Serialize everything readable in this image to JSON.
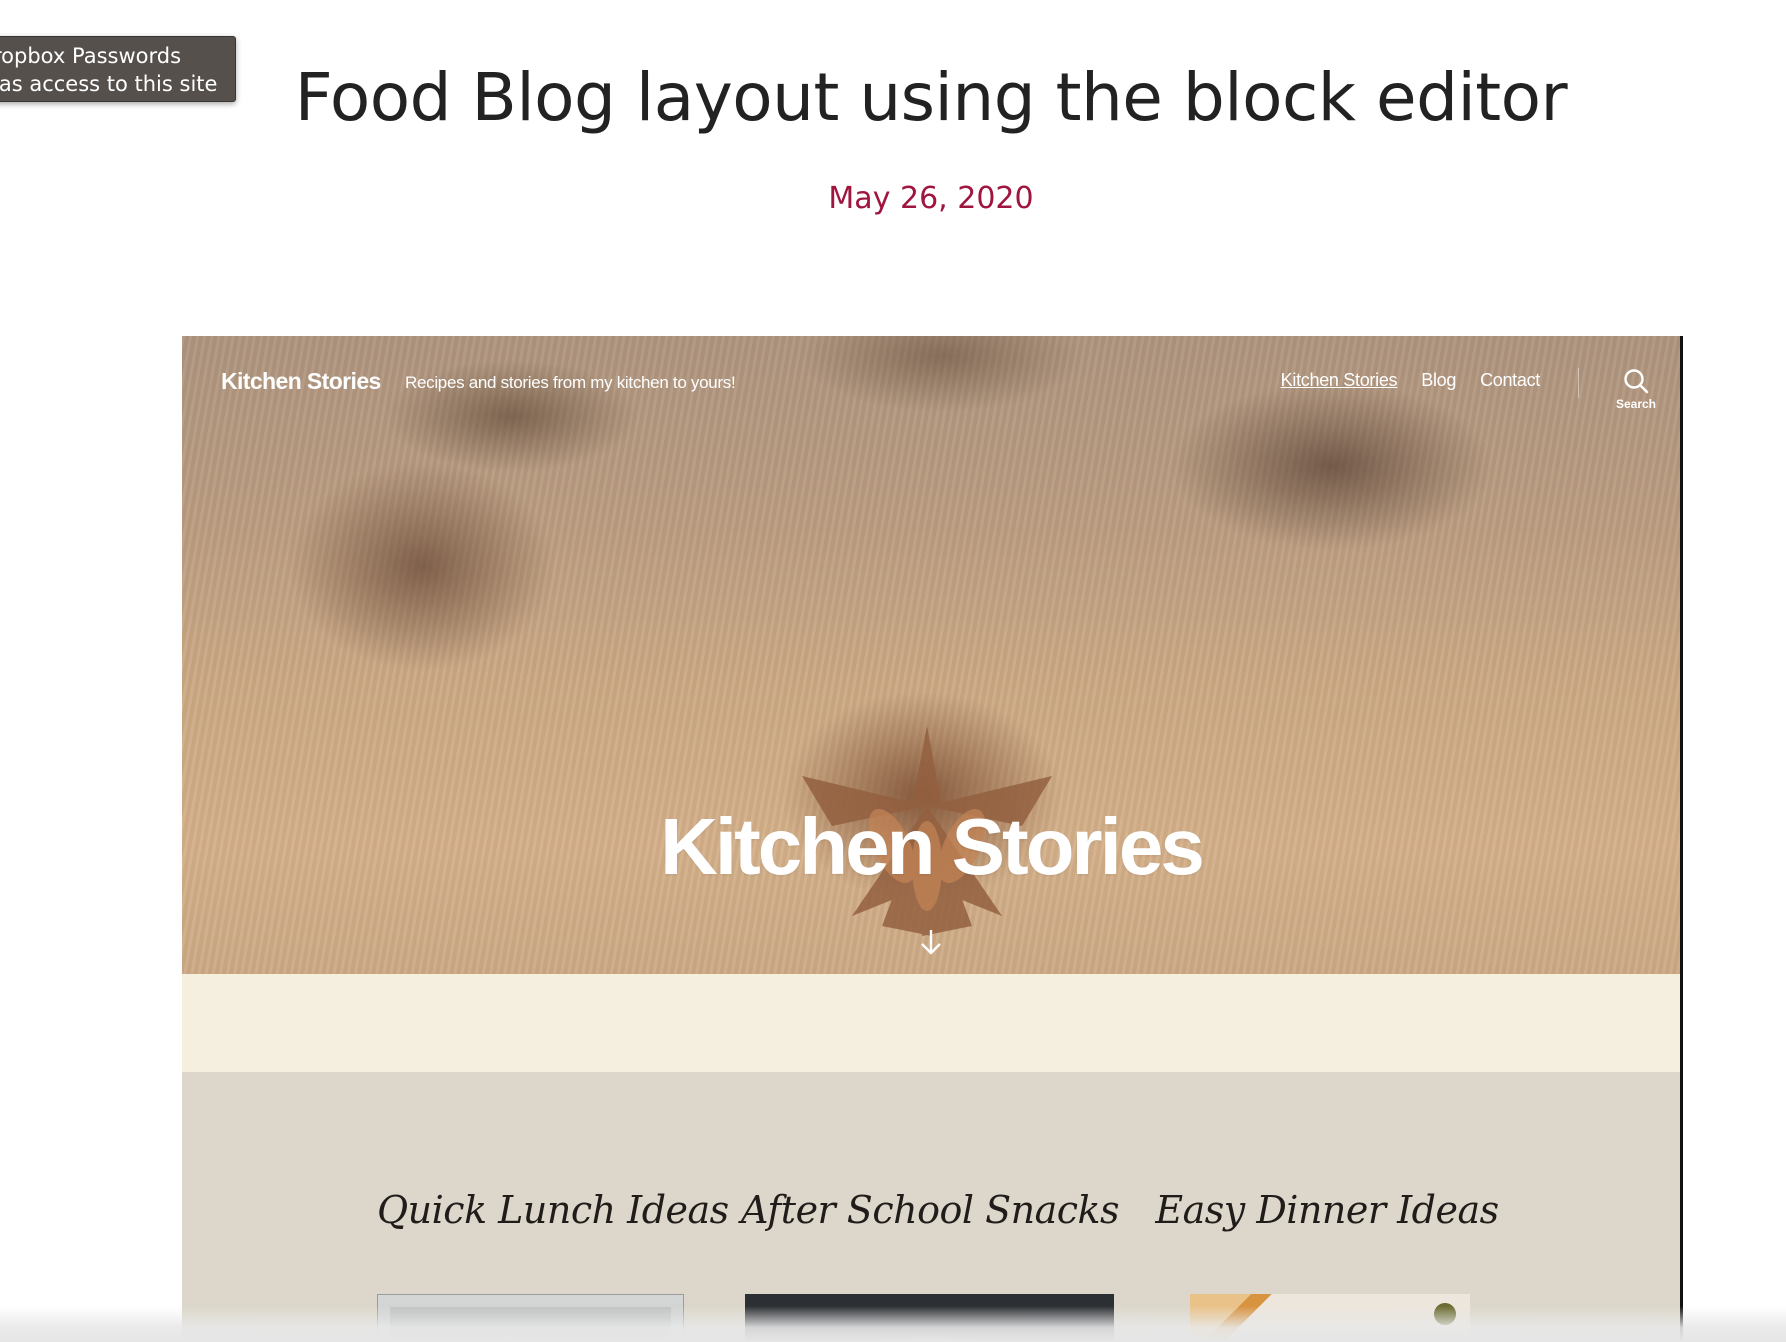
{
  "tooltip": {
    "line1": "ropbox Passwords",
    "line2": "las access to this site"
  },
  "post": {
    "title": "Food Blog layout using the block editor",
    "date": "May 26, 2020"
  },
  "embedded_site": {
    "site_title": "Kitchen Stories",
    "site_description": "Recipes and stories from my kitchen to yours!",
    "nav": [
      {
        "label": "Kitchen Stories",
        "current": true
      },
      {
        "label": "Blog",
        "current": false
      },
      {
        "label": "Contact",
        "current": false
      }
    ],
    "search_label": "Search",
    "hero_title": "Kitchen Stories",
    "cards": [
      {
        "title": "Quick Lunch Ideas"
      },
      {
        "title": "After School Snacks"
      },
      {
        "title": "Easy Dinner Ideas"
      }
    ],
    "colors": {
      "date_accent": "#a0153e",
      "band": "#f5efe0",
      "cards_background": "#dcd7ca"
    }
  }
}
